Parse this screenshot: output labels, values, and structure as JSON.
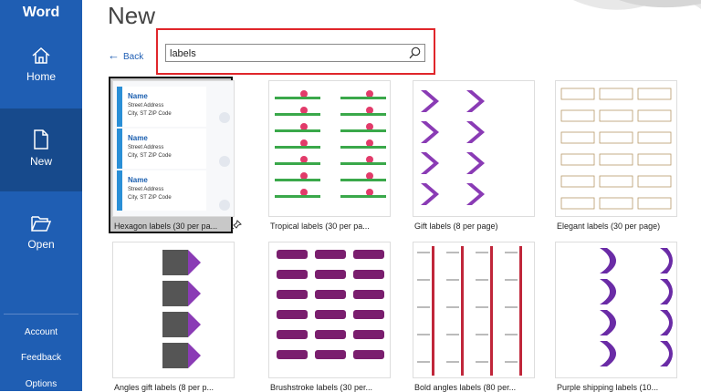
{
  "app": {
    "title": "Word"
  },
  "nav": {
    "home": "Home",
    "new": "New",
    "open": "Open",
    "account": "Account",
    "feedback": "Feedback",
    "options": "Options"
  },
  "page": {
    "title": "New",
    "back_label": "Back"
  },
  "search": {
    "value": "labels"
  },
  "colors": {
    "sidebar": "#1f5eb3",
    "selected_nav": "#174a8c",
    "highlight": "#e0262b"
  },
  "templates": [
    {
      "label": "Hexagon labels (30 per pa...",
      "selected": true,
      "card": {
        "name": "Name",
        "line1": "Street Address",
        "line2": "City, ST ZIP Code"
      }
    },
    {
      "label": "Tropical labels (30 per pa..."
    },
    {
      "label": "Gift labels (8 per page)"
    },
    {
      "label": "Elegant labels (30 per page)"
    },
    {
      "label": "Angles gift labels (8 per p..."
    },
    {
      "label": "Brushstroke labels (30 per..."
    },
    {
      "label": "Bold angles labels (80 per..."
    },
    {
      "label": "Purple shipping labels (10..."
    }
  ]
}
